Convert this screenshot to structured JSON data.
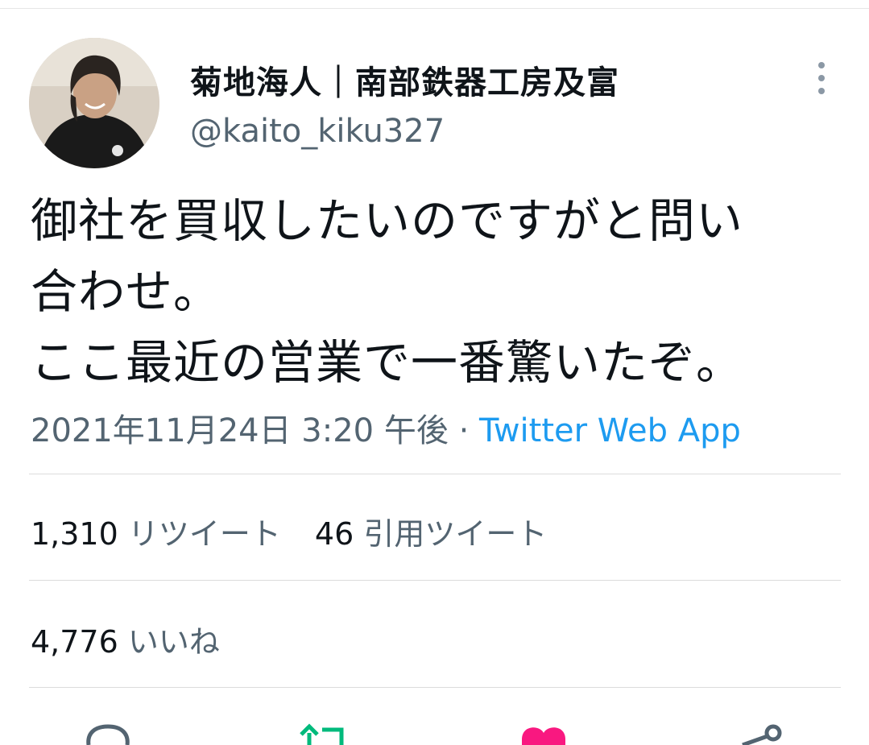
{
  "author": {
    "display_name": "菊地海人｜南部鉄器工房及富",
    "handle": "@kaito_kiku327"
  },
  "tweet": {
    "text": "御社を買収したいのですがと問い\n合わせ。\nここ最近の営業で一番驚いたぞ。",
    "timestamp": "2021年11月24日 3:20 午後",
    "separator": " · ",
    "source": "Twitter Web App"
  },
  "stats": {
    "retweets_count": "1,310",
    "retweets_label": "リツイート",
    "quotes_count": "46",
    "quotes_label": "引用ツイート",
    "likes_count": "4,776",
    "likes_label": "いいね"
  },
  "actions": [
    {
      "icon": "reply-icon",
      "color": "#536471"
    },
    {
      "icon": "retweet-icon",
      "color": "#00ba7c"
    },
    {
      "icon": "like-icon",
      "color": "#f91880"
    },
    {
      "icon": "share-icon",
      "color": "#536471"
    }
  ],
  "colors": {
    "link": "#1d9bf0",
    "secondary_text": "#536471",
    "retweet_active": "#00ba7c",
    "like_active": "#f91880"
  }
}
